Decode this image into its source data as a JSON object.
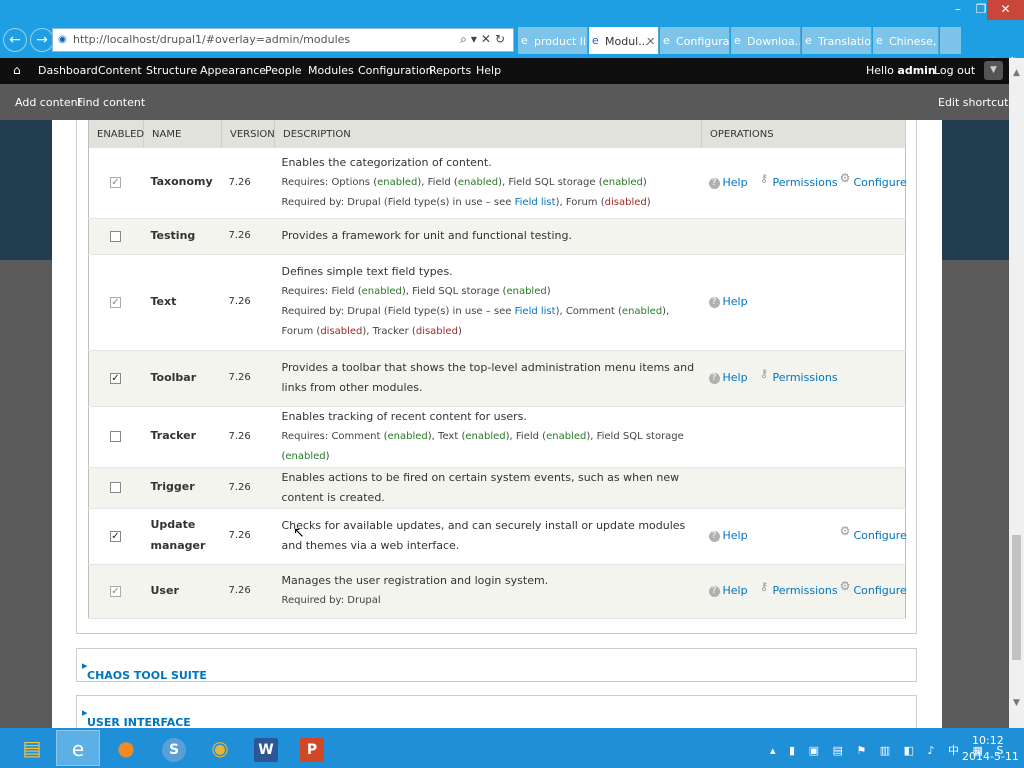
{
  "browser": {
    "address": "http://localhost/drupal1/#overlay=admin/modules",
    "tabs": [
      "product li...",
      "Modul...",
      "Configura...",
      "Downloa...",
      "Translatio...",
      "Chinese, ..."
    ],
    "close_glyph": "✕",
    "window_buttons": {
      "min": "–",
      "restore": "❐",
      "close": "✕"
    }
  },
  "toolbar": {
    "items": [
      "Dashboard",
      "Content",
      "Structure",
      "Appearance",
      "People",
      "Modules",
      "Configuration",
      "Reports",
      "Help"
    ],
    "hello_prefix": "Hello",
    "user": "admin",
    "logout": "Log out"
  },
  "shortcuts": {
    "items": [
      "Add content",
      "Find content"
    ],
    "edit": "Edit shortcuts"
  },
  "table": {
    "headers": {
      "enabled": "ENABLED",
      "name": "NAME",
      "version": "VERSION",
      "description": "DESCRIPTION",
      "operations": "OPERATIONS"
    },
    "ops": {
      "help": "Help",
      "permissions": "Permissions",
      "configure": "Configure"
    },
    "words": {
      "requires": "Requires:",
      "required_by": "Required by:",
      "drupal": "Drupal",
      "field_types": "Drupal (Field type(s) in use – see",
      "field_list": "Field list",
      "options": "Options",
      "field": "Field",
      "field_sql": "Field SQL storage",
      "forum": "Forum",
      "comment": "Comment",
      "text": "Text",
      "tracker": "Tracker",
      "enabled": "enabled",
      "disabled": "disabled",
      "check": "✓"
    },
    "rows": {
      "taxonomy": {
        "name": "Taxonomy",
        "version": "7.26",
        "desc": "Enables the categorization of content."
      },
      "testing": {
        "name": "Testing",
        "version": "7.26",
        "desc": "Provides a framework for unit and functional testing."
      },
      "text": {
        "name": "Text",
        "version": "7.26",
        "desc": "Defines simple text field types."
      },
      "toolbar": {
        "name": "Toolbar",
        "version": "7.26",
        "desc": "Provides a toolbar that shows the top-level administration menu items and links from other modules."
      },
      "tracker": {
        "name": "Tracker",
        "version": "7.26",
        "desc": "Enables tracking of recent content for users."
      },
      "trigger": {
        "name": "Trigger",
        "version": "7.26",
        "desc": "Enables actions to be fired on certain system events, such as when new content is created."
      },
      "update": {
        "name": "Update manager",
        "version": "7.26",
        "desc": "Checks for available updates, and can securely install or update modules and themes via a web interface."
      },
      "user": {
        "name": "User",
        "version": "7.26",
        "desc": "Manages the user registration and login system."
      }
    }
  },
  "sections": [
    "CHAOS TOOL SUITE",
    "USER INTERFACE"
  ],
  "clock": {
    "time": "10:12",
    "date": "2014-5-11"
  },
  "taskbar": {
    "word_label": "W",
    "ppt_label": "P",
    "skype_label": "S"
  },
  "colors": {
    "browser": "#1f9fe3",
    "toolbar": "#0f0f0f",
    "link": "#0074bd",
    "enabled": "#267b26",
    "disabled": "#9d2a25",
    "taskbar": "#1f8fd8"
  }
}
